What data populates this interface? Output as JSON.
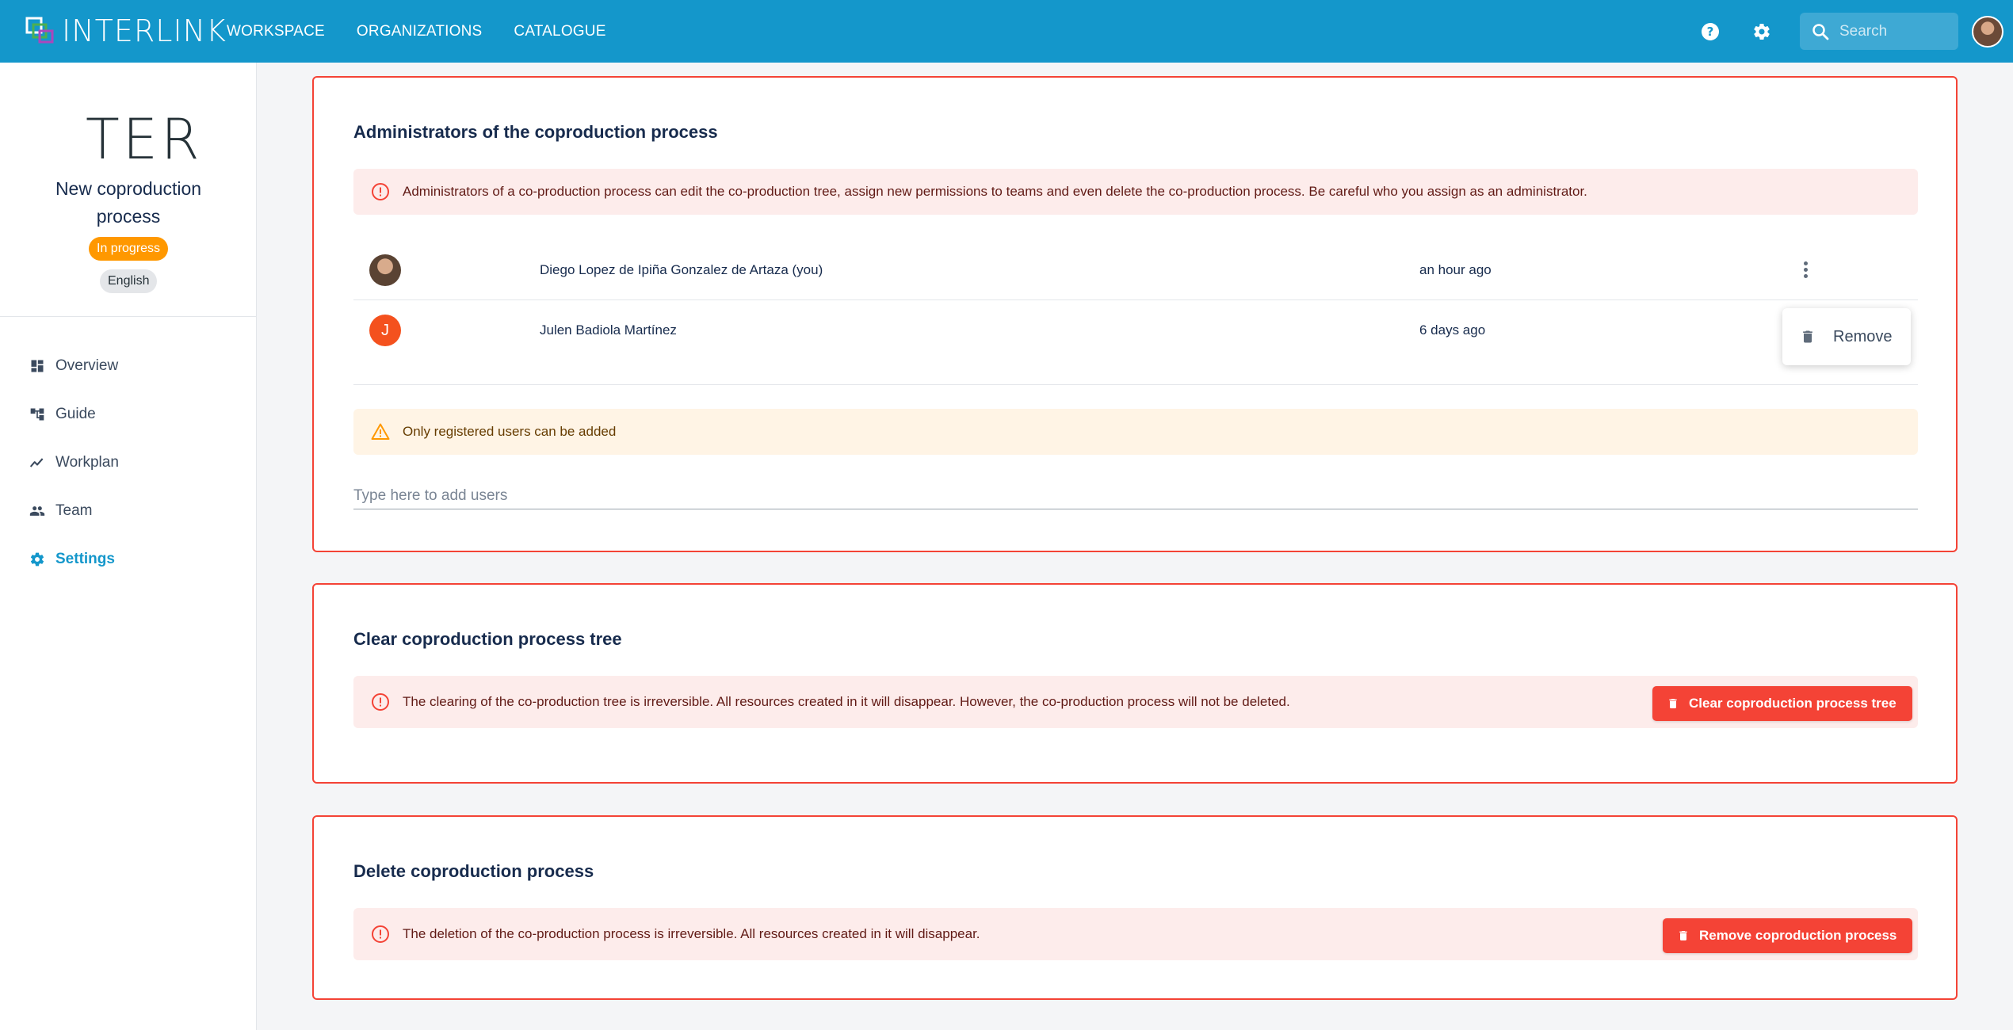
{
  "header": {
    "logo_text": "INTERLINK",
    "nav": [
      "WORKSPACE",
      "ORGANIZATIONS",
      "CATALOGUE"
    ],
    "search_placeholder": "Search",
    "icons": [
      "help-icon",
      "gear-icon",
      "search-icon"
    ],
    "bg_color": "#1497cb"
  },
  "sidebar": {
    "project_logo_text": "TER",
    "project_name": "New coproduction process",
    "status": "In progress",
    "language": "English",
    "items": [
      {
        "label": "Overview",
        "icon": "dashboard-icon"
      },
      {
        "label": "Guide",
        "icon": "tree-icon"
      },
      {
        "label": "Workplan",
        "icon": "timeline-icon"
      },
      {
        "label": "Team",
        "icon": "people-icon"
      },
      {
        "label": "Settings",
        "icon": "gear-icon",
        "active": true
      }
    ]
  },
  "admins_card": {
    "title": "Administrators of the coproduction process",
    "alert": "Administrators of a co-production process can edit the co-production tree, assign new permissions to teams and even delete the co-production process. Be careful who you assign as an administrator.",
    "rows": [
      {
        "name": "Diego Lopez de Ipiña Gonzalez de Artaza (you)",
        "time": "an hour ago",
        "avatar": "photo"
      },
      {
        "name": "Julen Badiola Martínez",
        "time": "6 days ago",
        "avatar_initial": "J"
      }
    ],
    "menu_remove": "Remove",
    "warning": "Only registered users can be added",
    "add_placeholder": "Type here to add users"
  },
  "clear_card": {
    "title": "Clear coproduction process tree",
    "alert": "The clearing of the co-production tree is irreversible. All resources created in it will disappear. However, the co-production process will not be deleted.",
    "button": "Clear coproduction process tree"
  },
  "delete_card": {
    "title": "Delete coproduction process",
    "alert": "The deletion of the co-production process is irreversible. All resources created in it will disappear.",
    "button": "Remove coproduction process"
  },
  "colors": {
    "accent": "#1497cb",
    "danger": "#f44336",
    "status_orange": "#ff9800"
  }
}
